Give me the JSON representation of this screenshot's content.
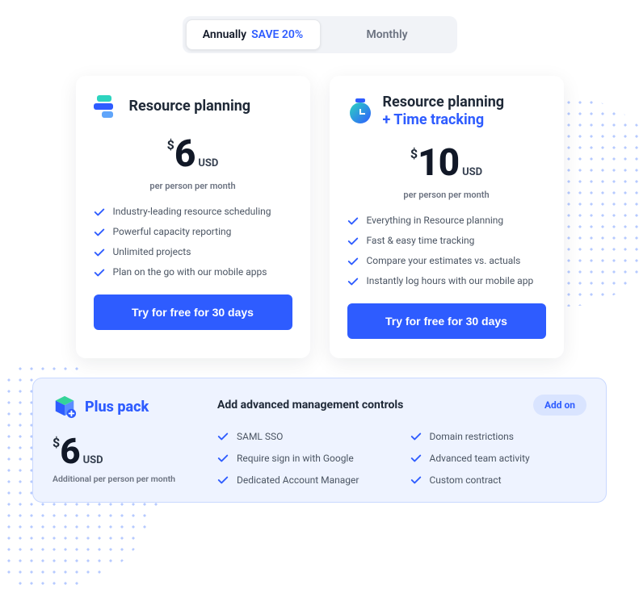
{
  "toggle": {
    "annual_label": "Annually",
    "annual_save": "SAVE 20%",
    "monthly_label": "Monthly"
  },
  "plans": [
    {
      "title": "Resource planning",
      "title_line2": "",
      "currency": "$",
      "amount": "6",
      "usd": "USD",
      "per": "per person per month",
      "features": [
        "Industry-leading resource scheduling",
        "Powerful capacity reporting",
        "Unlimited projects",
        "Plan on the go with our mobile apps"
      ],
      "cta": "Try for free for 30 days"
    },
    {
      "title": "Resource planning",
      "title_line2": "+ Time tracking",
      "currency": "$",
      "amount": "10",
      "usd": "USD",
      "per": "per person per month",
      "features": [
        "Everything in Resource planning",
        "Fast & easy time tracking",
        "Compare your estimates vs. actuals",
        "Instantly log hours with our mobile app"
      ],
      "cta": "Try for free for 30 days"
    }
  ],
  "plus": {
    "title": "Plus pack",
    "currency": "$",
    "amount": "6",
    "usd": "USD",
    "per": "Additional per person per month",
    "desc": "Add advanced management controls",
    "badge": "Add on",
    "features": [
      "SAML SSO",
      "Domain restrictions",
      "Require sign in with Google",
      "Advanced team activity",
      "Dedicated Account Manager",
      "Custom contract"
    ]
  }
}
